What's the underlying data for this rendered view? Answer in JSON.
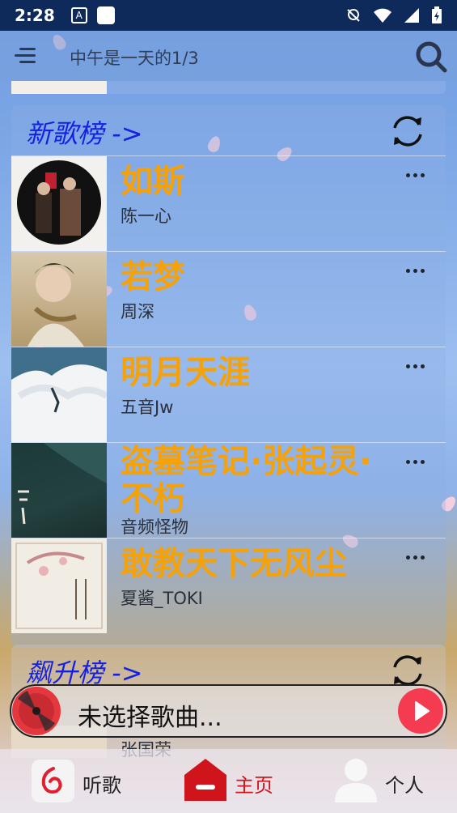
{
  "status_bar": {
    "time": "2:28",
    "a_icon": "A"
  },
  "app_bar": {
    "title": "中午是一天的1/3"
  },
  "new_songs": {
    "title": "新歌榜 ->",
    "songs": [
      {
        "title": "如斯",
        "artist": "陈一心"
      },
      {
        "title": "若梦",
        "artist": "周深"
      },
      {
        "title": "明月天涯",
        "artist": "五音Jw"
      },
      {
        "title": "盗墓笔记·张起灵·不朽",
        "artist": "音频怪物"
      },
      {
        "title": "敢教天下无风尘",
        "artist": "夏酱_TOKI"
      }
    ]
  },
  "rising": {
    "title": "飙升榜 ->",
    "peek_artist": "张国荣"
  },
  "player": {
    "text": "未选择歌曲..."
  },
  "nav": {
    "listen": "听歌",
    "home": "主页",
    "me": "个人"
  },
  "colors": {
    "accent_title": "#f5a20a",
    "link_blue": "#1520e0",
    "nav_active": "#d0141b",
    "play_red": "#f53b4f"
  }
}
